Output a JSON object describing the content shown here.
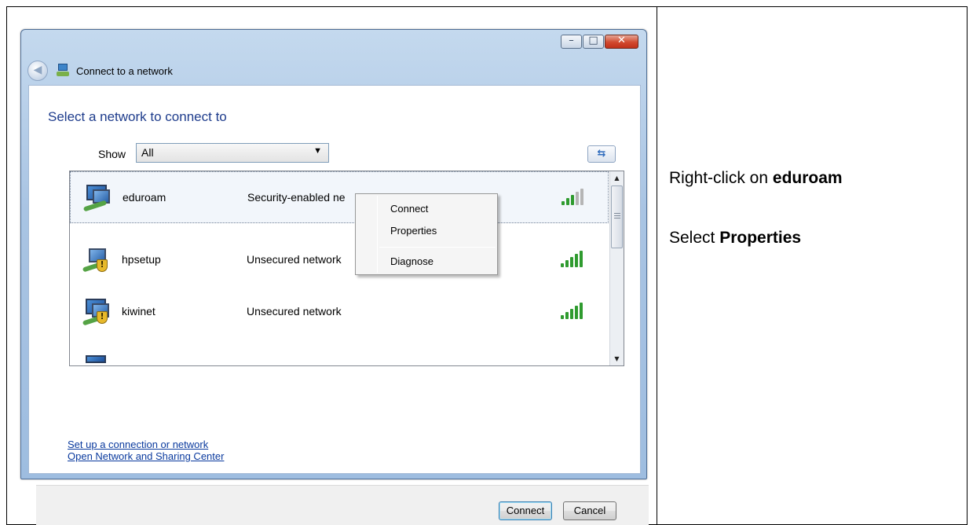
{
  "instructions": {
    "line1_prefix": "Right-click on ",
    "line1_bold": "eduroam",
    "line2_prefix": "Select ",
    "line2_bold": "Properties"
  },
  "window": {
    "nav_title": "Connect to a network",
    "heading": "Select a network to connect to",
    "show_label": "Show",
    "show_value": "All",
    "icons": {
      "back": "back-arrow-icon",
      "network": "network-icon",
      "refresh": "refresh-icon",
      "minimize": "minimize-icon",
      "maximize": "maximize-icon",
      "close": "close-icon"
    }
  },
  "networks": [
    {
      "name": "eduroam",
      "status": "Security-enabled ne",
      "signal_bars": 3,
      "icon": "secured-network-icon",
      "selected": true
    },
    {
      "name": "hpsetup",
      "status": "Unsecured network",
      "signal_bars": 5,
      "icon": "unsecured-adhoc-network-icon",
      "selected": false
    },
    {
      "name": "kiwinet",
      "status": "Unsecured network",
      "signal_bars": 5,
      "icon": "unsecured-network-icon",
      "selected": false
    }
  ],
  "context_menu": {
    "items": [
      "Connect",
      "Properties",
      "Diagnose"
    ]
  },
  "links": {
    "setup": "Set up a connection or network",
    "sharing": "Open Network and Sharing Center"
  },
  "buttons": {
    "connect": "Connect",
    "cancel": "Cancel"
  },
  "colors": {
    "heading": "#1e3c8c",
    "link": "#0a3a9e",
    "signal_on": "#2f9b2f",
    "signal_off": "#b5b5b5"
  }
}
